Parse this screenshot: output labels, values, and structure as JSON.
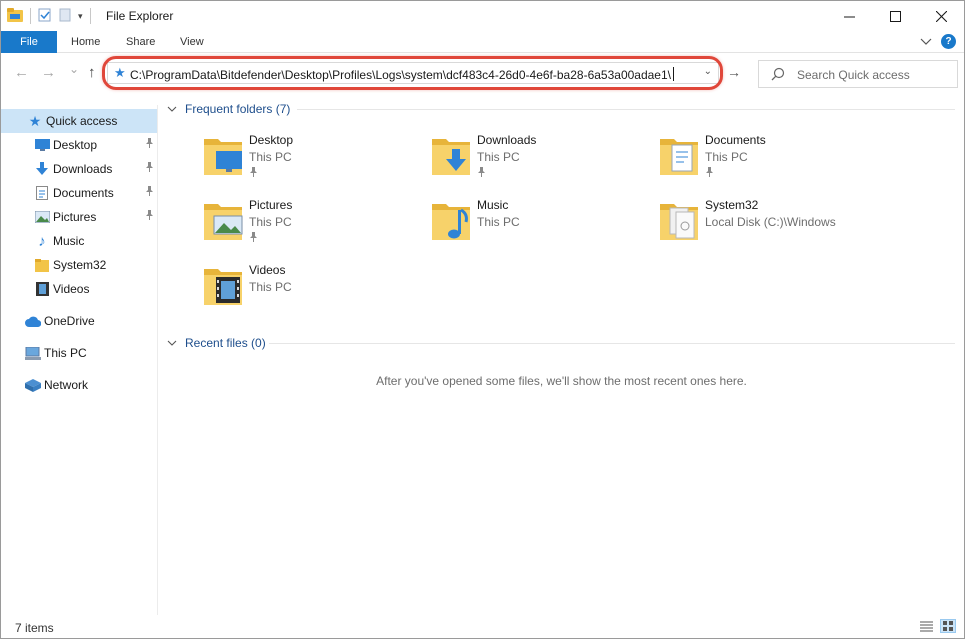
{
  "window": {
    "title": "File Explorer",
    "controls": {
      "minimize": "—",
      "maximize": "☐",
      "close": "✕"
    }
  },
  "ribbon": {
    "tabs": [
      "File",
      "Home",
      "Share",
      "View"
    ],
    "help_label": "?",
    "accent_color": "#1979ca"
  },
  "navigation": {
    "back": "←",
    "forward": "→",
    "recent": "⌄",
    "up": "↑",
    "address": "C:\\ProgramData\\Bitdefender\\Desktop\\Profiles\\Logs\\system\\dcf483c4-26d0-4e6f-ba28-6a53a00adae1\\",
    "address_chevron": "⌄",
    "go": "→",
    "search_placeholder": "Search Quick access",
    "highlight_color": "#e0473a"
  },
  "sidebar": {
    "quick_access": "Quick access",
    "items": [
      {
        "label": "Desktop",
        "icon": "desktop-icon",
        "pinned": true
      },
      {
        "label": "Downloads",
        "icon": "download-icon",
        "pinned": true
      },
      {
        "label": "Documents",
        "icon": "documents-icon",
        "pinned": true
      },
      {
        "label": "Pictures",
        "icon": "pictures-icon",
        "pinned": true
      },
      {
        "label": "Music",
        "icon": "music-icon",
        "pinned": false
      },
      {
        "label": "System32",
        "icon": "folder-icon",
        "pinned": false
      },
      {
        "label": "Videos",
        "icon": "videos-icon",
        "pinned": false
      }
    ],
    "onedrive": "OneDrive",
    "this_pc": "This PC",
    "network": "Network",
    "pin_glyph": "📌"
  },
  "content": {
    "frequent_header": "Frequent folders (7)",
    "folders": [
      {
        "name": "Desktop",
        "location": "This PC",
        "pinned": true,
        "overlay": "desktop-icon"
      },
      {
        "name": "Downloads",
        "location": "This PC",
        "pinned": true,
        "overlay": "download-icon"
      },
      {
        "name": "Documents",
        "location": "This PC",
        "pinned": true,
        "overlay": "documents-icon"
      },
      {
        "name": "Pictures",
        "location": "This PC",
        "pinned": true,
        "overlay": "pictures-icon"
      },
      {
        "name": "Music",
        "location": "This PC",
        "pinned": false,
        "overlay": "music-icon"
      },
      {
        "name": "System32",
        "location": "Local Disk (C:)\\Windows",
        "pinned": false,
        "overlay": "system-files-icon"
      },
      {
        "name": "Videos",
        "location": "This PC",
        "pinned": false,
        "overlay": "videos-icon"
      }
    ],
    "recent_header": "Recent files (0)",
    "recent_empty_message": "After you've opened some files, we'll show the most recent ones here."
  },
  "status": {
    "item_count": "7 items"
  }
}
